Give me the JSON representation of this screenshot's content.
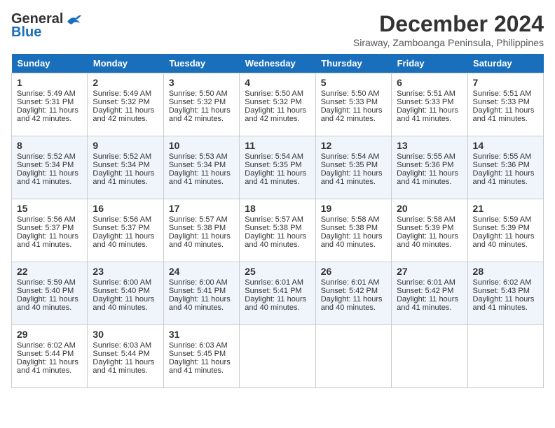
{
  "logo": {
    "line1": "General",
    "line2": "Blue"
  },
  "title": "December 2024",
  "location": "Siraway, Zamboanga Peninsula, Philippines",
  "headers": [
    "Sunday",
    "Monday",
    "Tuesday",
    "Wednesday",
    "Thursday",
    "Friday",
    "Saturday"
  ],
  "weeks": [
    [
      {
        "day": "1",
        "sunrise": "5:49 AM",
        "sunset": "5:31 PM",
        "daylight": "11 hours and 42 minutes."
      },
      {
        "day": "2",
        "sunrise": "5:49 AM",
        "sunset": "5:32 PM",
        "daylight": "11 hours and 42 minutes."
      },
      {
        "day": "3",
        "sunrise": "5:50 AM",
        "sunset": "5:32 PM",
        "daylight": "11 hours and 42 minutes."
      },
      {
        "day": "4",
        "sunrise": "5:50 AM",
        "sunset": "5:32 PM",
        "daylight": "11 hours and 42 minutes."
      },
      {
        "day": "5",
        "sunrise": "5:50 AM",
        "sunset": "5:33 PM",
        "daylight": "11 hours and 42 minutes."
      },
      {
        "day": "6",
        "sunrise": "5:51 AM",
        "sunset": "5:33 PM",
        "daylight": "11 hours and 41 minutes."
      },
      {
        "day": "7",
        "sunrise": "5:51 AM",
        "sunset": "5:33 PM",
        "daylight": "11 hours and 41 minutes."
      }
    ],
    [
      {
        "day": "8",
        "sunrise": "5:52 AM",
        "sunset": "5:34 PM",
        "daylight": "11 hours and 41 minutes."
      },
      {
        "day": "9",
        "sunrise": "5:52 AM",
        "sunset": "5:34 PM",
        "daylight": "11 hours and 41 minutes."
      },
      {
        "day": "10",
        "sunrise": "5:53 AM",
        "sunset": "5:34 PM",
        "daylight": "11 hours and 41 minutes."
      },
      {
        "day": "11",
        "sunrise": "5:54 AM",
        "sunset": "5:35 PM",
        "daylight": "11 hours and 41 minutes."
      },
      {
        "day": "12",
        "sunrise": "5:54 AM",
        "sunset": "5:35 PM",
        "daylight": "11 hours and 41 minutes."
      },
      {
        "day": "13",
        "sunrise": "5:55 AM",
        "sunset": "5:36 PM",
        "daylight": "11 hours and 41 minutes."
      },
      {
        "day": "14",
        "sunrise": "5:55 AM",
        "sunset": "5:36 PM",
        "daylight": "11 hours and 41 minutes."
      }
    ],
    [
      {
        "day": "15",
        "sunrise": "5:56 AM",
        "sunset": "5:37 PM",
        "daylight": "11 hours and 41 minutes."
      },
      {
        "day": "16",
        "sunrise": "5:56 AM",
        "sunset": "5:37 PM",
        "daylight": "11 hours and 40 minutes."
      },
      {
        "day": "17",
        "sunrise": "5:57 AM",
        "sunset": "5:38 PM",
        "daylight": "11 hours and 40 minutes."
      },
      {
        "day": "18",
        "sunrise": "5:57 AM",
        "sunset": "5:38 PM",
        "daylight": "11 hours and 40 minutes."
      },
      {
        "day": "19",
        "sunrise": "5:58 AM",
        "sunset": "5:38 PM",
        "daylight": "11 hours and 40 minutes."
      },
      {
        "day": "20",
        "sunrise": "5:58 AM",
        "sunset": "5:39 PM",
        "daylight": "11 hours and 40 minutes."
      },
      {
        "day": "21",
        "sunrise": "5:59 AM",
        "sunset": "5:39 PM",
        "daylight": "11 hours and 40 minutes."
      }
    ],
    [
      {
        "day": "22",
        "sunrise": "5:59 AM",
        "sunset": "5:40 PM",
        "daylight": "11 hours and 40 minutes."
      },
      {
        "day": "23",
        "sunrise": "6:00 AM",
        "sunset": "5:40 PM",
        "daylight": "11 hours and 40 minutes."
      },
      {
        "day": "24",
        "sunrise": "6:00 AM",
        "sunset": "5:41 PM",
        "daylight": "11 hours and 40 minutes."
      },
      {
        "day": "25",
        "sunrise": "6:01 AM",
        "sunset": "5:41 PM",
        "daylight": "11 hours and 40 minutes."
      },
      {
        "day": "26",
        "sunrise": "6:01 AM",
        "sunset": "5:42 PM",
        "daylight": "11 hours and 40 minutes."
      },
      {
        "day": "27",
        "sunrise": "6:01 AM",
        "sunset": "5:42 PM",
        "daylight": "11 hours and 41 minutes."
      },
      {
        "day": "28",
        "sunrise": "6:02 AM",
        "sunset": "5:43 PM",
        "daylight": "11 hours and 41 minutes."
      }
    ],
    [
      {
        "day": "29",
        "sunrise": "6:02 AM",
        "sunset": "5:44 PM",
        "daylight": "11 hours and 41 minutes."
      },
      {
        "day": "30",
        "sunrise": "6:03 AM",
        "sunset": "5:44 PM",
        "daylight": "11 hours and 41 minutes."
      },
      {
        "day": "31",
        "sunrise": "6:03 AM",
        "sunset": "5:45 PM",
        "daylight": "11 hours and 41 minutes."
      },
      null,
      null,
      null,
      null
    ]
  ]
}
